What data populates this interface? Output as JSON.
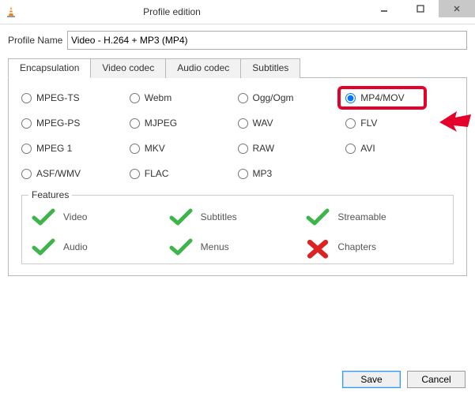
{
  "window": {
    "title": "Profile edition"
  },
  "profile": {
    "label": "Profile Name",
    "value": "Video - H.264 + MP3 (MP4)"
  },
  "tabs": {
    "encapsulation": "Encapsulation",
    "video_codec": "Video codec",
    "audio_codec": "Audio codec",
    "subtitles": "Subtitles"
  },
  "radios": {
    "mpeg_ts": "MPEG-TS",
    "webm": "Webm",
    "ogg": "Ogg/Ogm",
    "mp4": "MP4/MOV",
    "mpeg_ps": "MPEG-PS",
    "mjpeg": "MJPEG",
    "wav": "WAV",
    "flv": "FLV",
    "mpeg1": "MPEG 1",
    "mkv": "MKV",
    "raw": "RAW",
    "avi": "AVI",
    "asf": "ASF/WMV",
    "flac": "FLAC",
    "mp3": "MP3"
  },
  "features": {
    "legend": "Features",
    "video": "Video",
    "subtitles": "Subtitles",
    "streamable": "Streamable",
    "audio": "Audio",
    "menus": "Menus",
    "chapters": "Chapters"
  },
  "buttons": {
    "save": "Save",
    "cancel": "Cancel"
  }
}
